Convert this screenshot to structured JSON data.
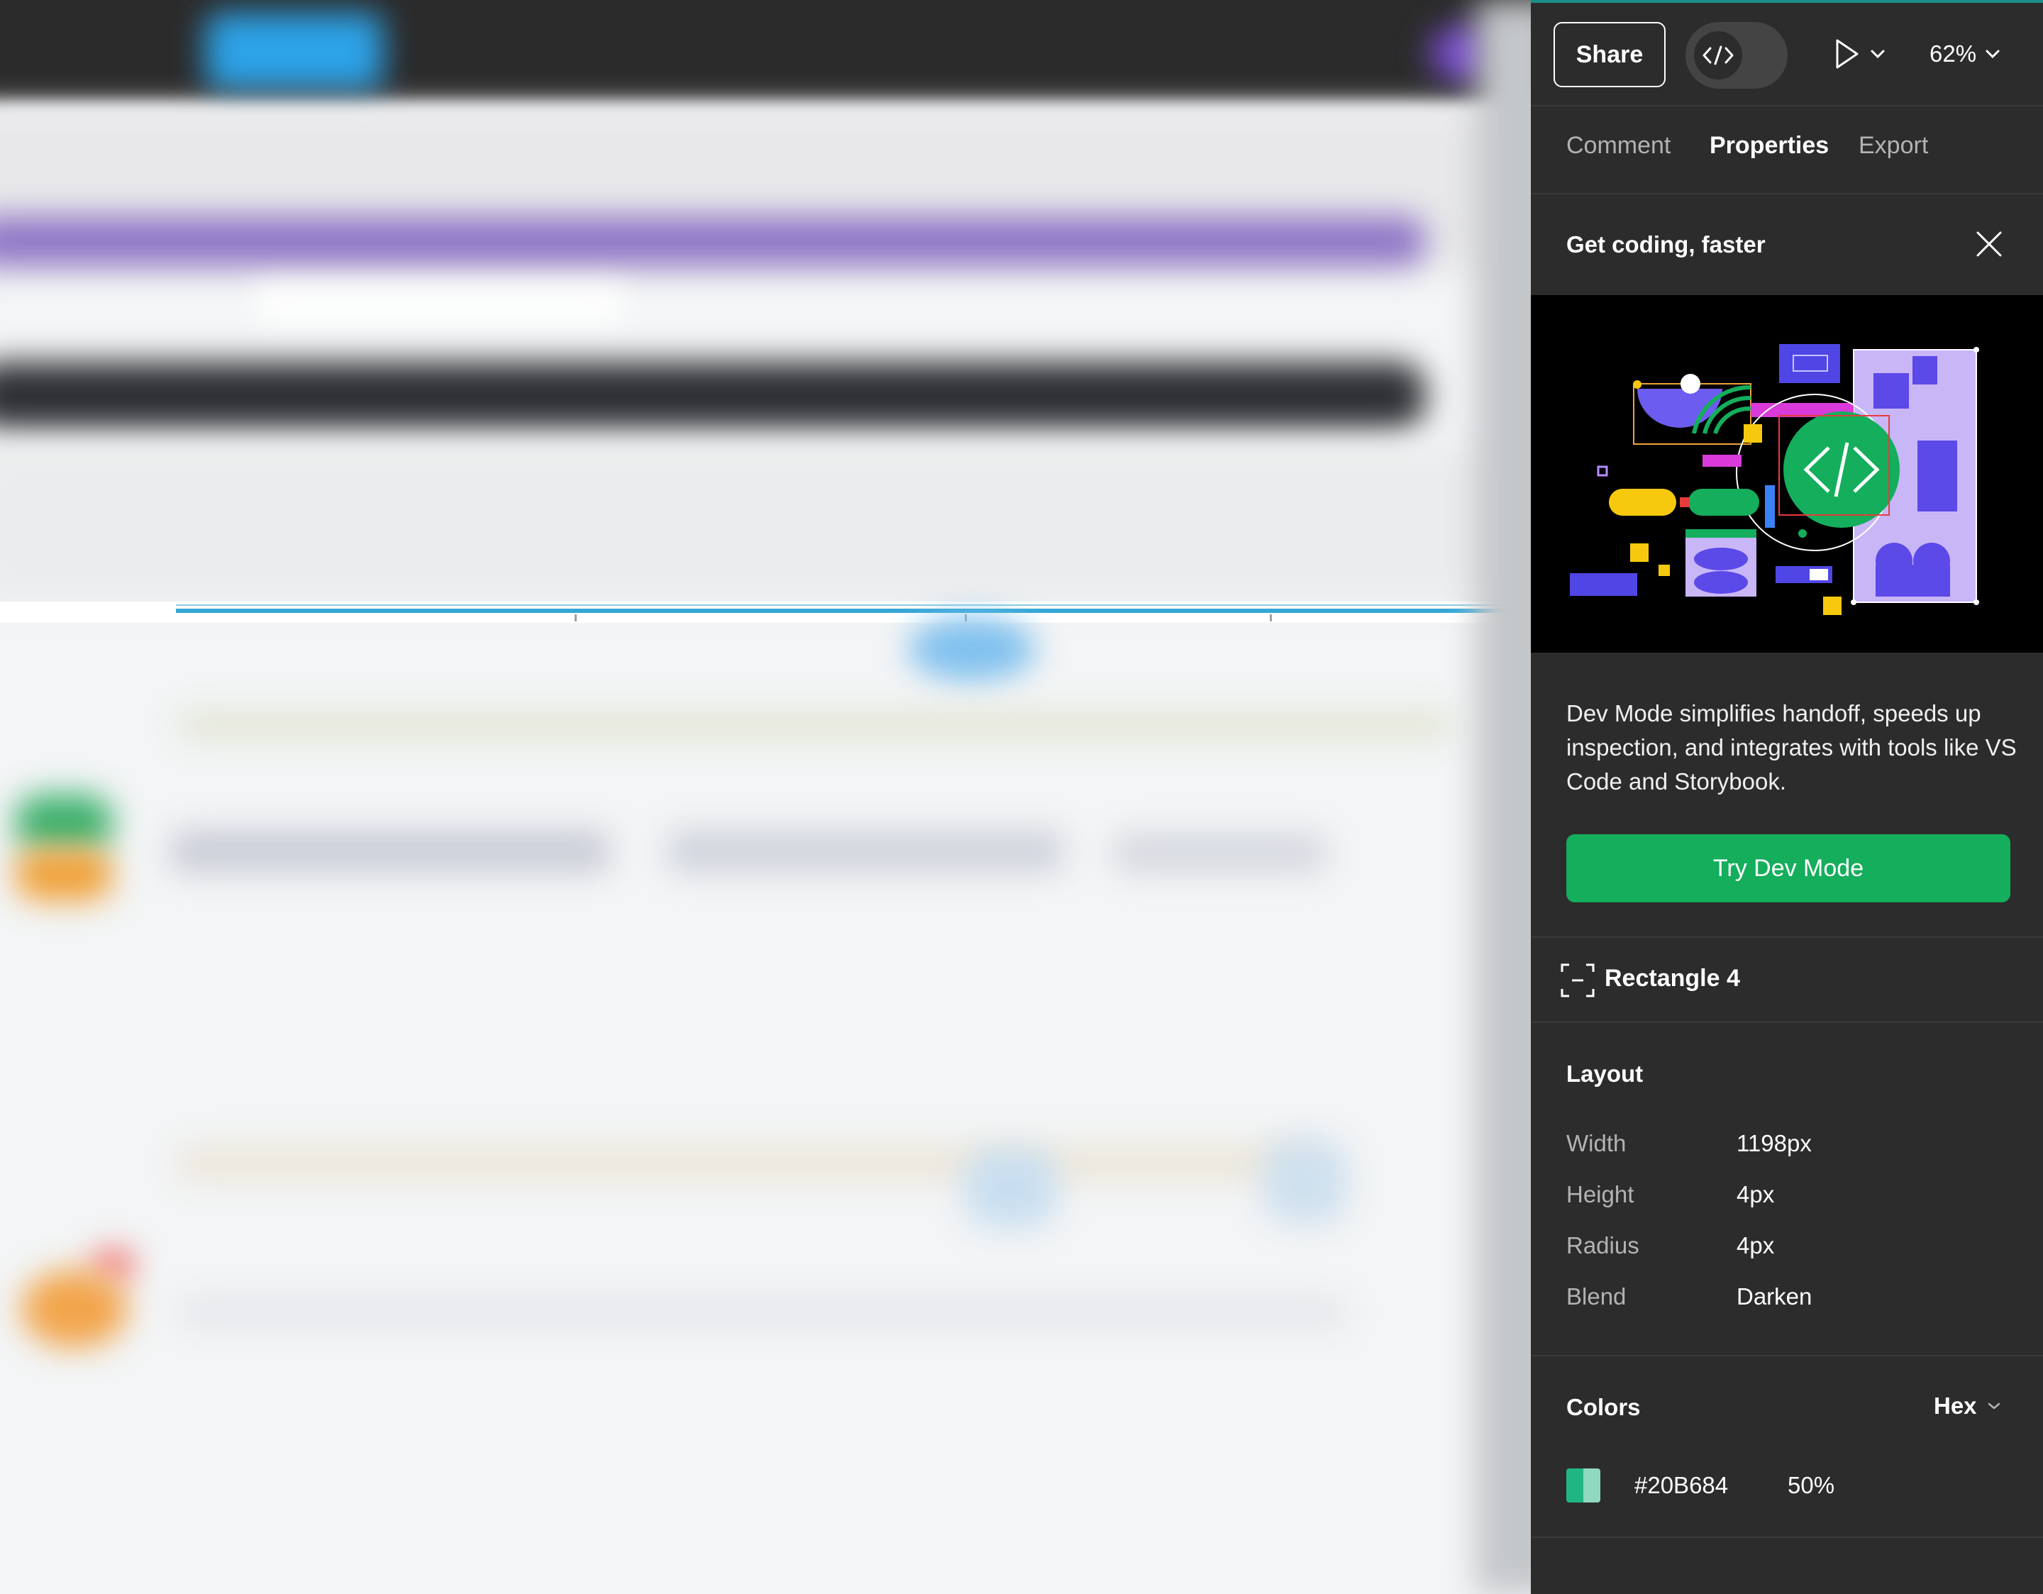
{
  "toolbar": {
    "share_label": "Share",
    "zoom_label": "62%"
  },
  "tabs": [
    {
      "label": "Comment"
    },
    {
      "label": "Properties"
    },
    {
      "label": "Export"
    }
  ],
  "promo": {
    "title": "Get coding, faster",
    "description": "Dev Mode simplifies handoff, speeds up inspection, and integrates with tools like VS Code and Storybook.",
    "cta_label": "Try Dev Mode"
  },
  "selection": {
    "name": "Rectangle 4"
  },
  "layout": {
    "title": "Layout",
    "rows": [
      {
        "label": "Width",
        "value": "1198px"
      },
      {
        "label": "Height",
        "value": "4px"
      },
      {
        "label": "Radius",
        "value": "4px"
      },
      {
        "label": "Blend",
        "value": "Darken"
      }
    ]
  },
  "colors": {
    "title": "Colors",
    "format": "Hex",
    "items": [
      {
        "hex": "#20B684",
        "opacity": "50%",
        "swatch": "#20B684"
      }
    ]
  },
  "theme": {
    "panel_bg": "#2C2C2C",
    "accent_green": "#14AE5C",
    "muted_text": "#B3B3B3"
  },
  "icons": [
    "code-icon",
    "play-icon",
    "chevron-down-icon",
    "close-icon",
    "rectangle-frame-icon"
  ]
}
